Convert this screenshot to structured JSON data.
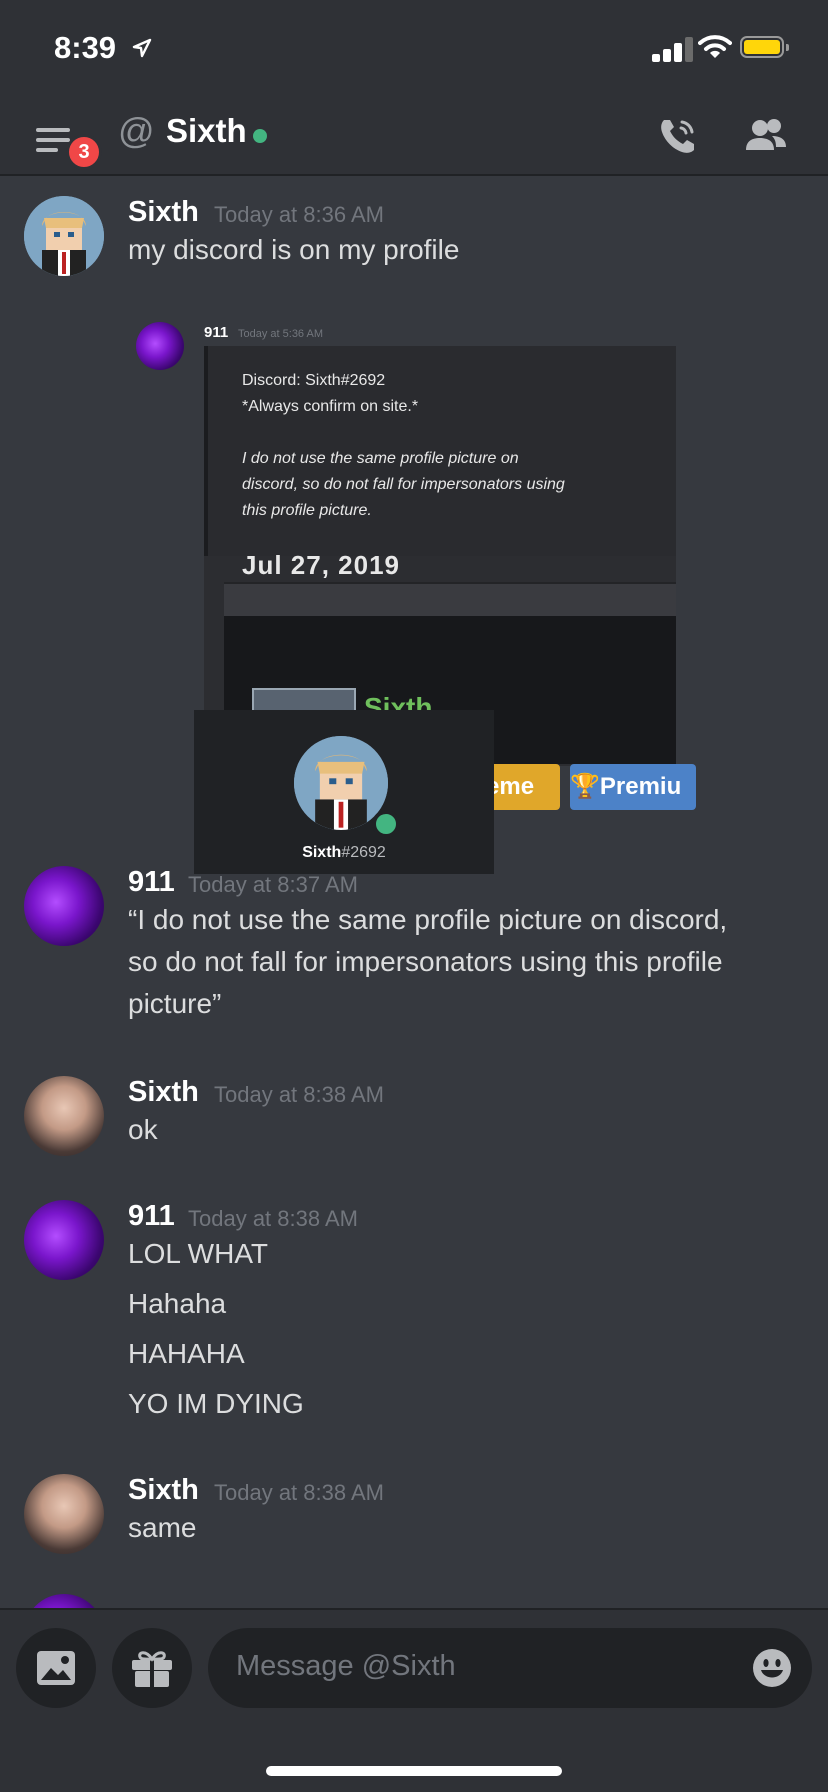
{
  "status_bar": {
    "time": "8:39"
  },
  "header": {
    "badge_count": "3",
    "at": "@",
    "title": "Sixth",
    "online_color": "#43b581"
  },
  "messages": [
    {
      "user": "Sixth",
      "time": "Today at 8:36 AM",
      "lines": [
        "my discord is on my profile"
      ]
    },
    {
      "user": "911",
      "time": "Today at 8:37 AM",
      "lines": [
        "“I do not use the same profile picture on discord,",
        "so do not fall for impersonators using this profile",
        "picture”"
      ]
    },
    {
      "user": "Sixth",
      "time": "Today at 8:38 AM",
      "lines": [
        "ok"
      ]
    },
    {
      "user": "911",
      "time": "Today at 8:38 AM",
      "lines": [
        "LOL WHAT",
        "Hahaha",
        "HAHAHA",
        "YO IM DYING"
      ]
    },
    {
      "user": "Sixth",
      "time": "Today at 8:38 AM",
      "lines": [
        "same"
      ]
    }
  ],
  "embed": {
    "user": "911",
    "time": "Today at 5:36 AM",
    "lines": [
      "Discord: Sixth#2692",
      "*Always confirm on site.*",
      "I do not use the same profile picture on",
      "discord, so do not fall for impersonators using",
      "this profile picture."
    ],
    "date_cut": "Jul 27, 2019",
    "profile_name": "Sixth",
    "btn_yellow": "eme",
    "btn_blue": "Premiu",
    "popup_name": "Sixth",
    "popup_disc": "#2692"
  },
  "composer": {
    "placeholder": "Message @Sixth"
  }
}
